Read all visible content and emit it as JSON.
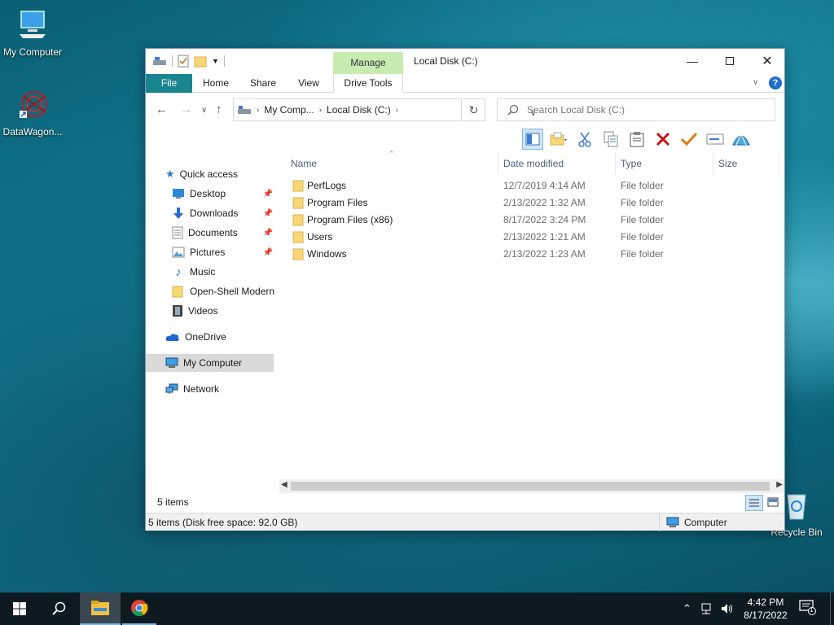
{
  "desktop": {
    "icons": [
      {
        "label": "My Computer"
      },
      {
        "label": "DataWagon..."
      },
      {
        "label": "Recycle Bin"
      }
    ]
  },
  "window": {
    "title": "Local Disk (C:)",
    "manage_label": "Manage",
    "tabs": {
      "file": "File",
      "home": "Home",
      "share": "Share",
      "view": "View",
      "drive_tools": "Drive Tools"
    },
    "help": "?",
    "address": {
      "crumbs": [
        "My Comp...",
        "Local Disk (C:)"
      ]
    },
    "search_placeholder": "Search Local Disk (C:)",
    "nav_pane": {
      "quick_access": "Quick access",
      "pinned": [
        {
          "label": "Desktop"
        },
        {
          "label": "Downloads"
        },
        {
          "label": "Documents"
        },
        {
          "label": "Pictures"
        }
      ],
      "others": [
        {
          "label": "Music"
        },
        {
          "label": "Open-Shell Modern"
        },
        {
          "label": "Videos"
        }
      ],
      "onedrive": "OneDrive",
      "my_computer": "My Computer",
      "network": "Network"
    },
    "columns": {
      "name": "Name",
      "date": "Date modified",
      "type": "Type",
      "size": "Size"
    },
    "files": [
      {
        "name": "PerfLogs",
        "date": "12/7/2019 4:14 AM",
        "type": "File folder"
      },
      {
        "name": "Program Files",
        "date": "2/13/2022 1:32 AM",
        "type": "File folder"
      },
      {
        "name": "Program Files (x86)",
        "date": "8/17/2022 3:24 PM",
        "type": "File folder"
      },
      {
        "name": "Users",
        "date": "2/13/2022 1:21 AM",
        "type": "File folder"
      },
      {
        "name": "Windows",
        "date": "2/13/2022 1:23 AM",
        "type": "File folder"
      }
    ],
    "status_count": "5 items",
    "status_disk": "5 items (Disk free space: 92.0 GB)",
    "status_zone": "Computer"
  },
  "taskbar": {
    "time": "4:42 PM",
    "date": "8/17/2022",
    "notification_count": "1"
  },
  "colors": {
    "file_tab": "#19868f",
    "manage_tab": "#c8ecb0",
    "selection": "#dadada",
    "taskbar": "#0d1a22"
  }
}
